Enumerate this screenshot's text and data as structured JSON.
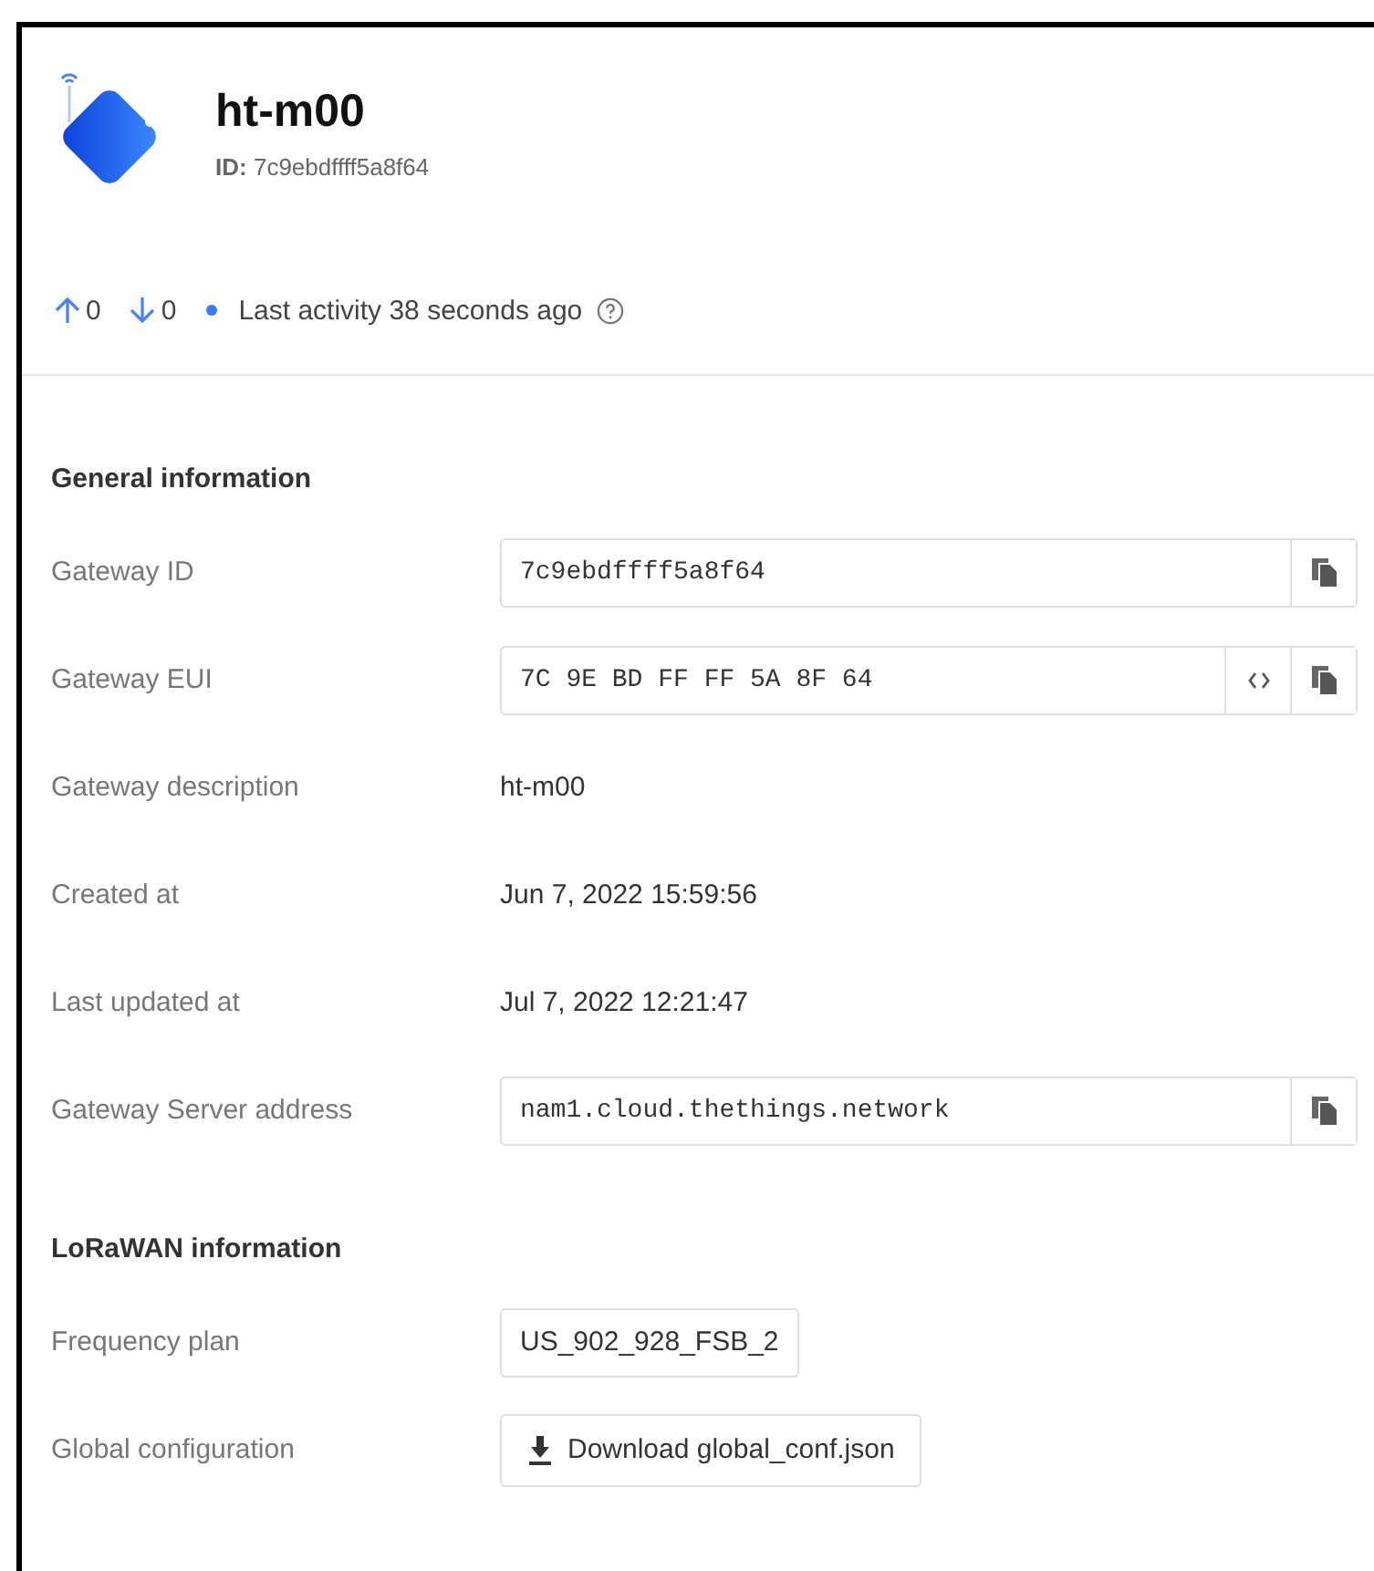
{
  "header": {
    "title": "ht-m00",
    "id_label": "ID:",
    "id_value": "7c9ebdffff5a8f64"
  },
  "stats": {
    "uplink": "0",
    "downlink": "0",
    "activity": "Last activity 38 seconds ago"
  },
  "sections": [
    {
      "title": "General information",
      "rows": [
        {
          "kind": "field",
          "label": "Gateway ID",
          "value": "7c9ebdffff5a8f64",
          "hex_toggle": false
        },
        {
          "kind": "field",
          "label": "Gateway EUI",
          "value": "7C 9E BD FF FF 5A 8F 64",
          "hex_toggle": true
        },
        {
          "kind": "text",
          "label": "Gateway description",
          "value": "ht-m00"
        },
        {
          "kind": "text",
          "label": "Created at",
          "value": "Jun 7, 2022 15:59:56"
        },
        {
          "kind": "text",
          "label": "Last updated at",
          "value": "Jul 7, 2022 12:21:47"
        },
        {
          "kind": "field",
          "label": "Gateway Server address",
          "value": "nam1.cloud.thethings.network",
          "hex_toggle": false
        }
      ]
    },
    {
      "title": "LoRaWAN information",
      "rows": [
        {
          "kind": "tag",
          "label": "Frequency plan",
          "value": "US_902_928_FSB_2"
        },
        {
          "kind": "button",
          "label": "Global configuration",
          "value": "Download global_conf.json"
        }
      ]
    }
  ]
}
